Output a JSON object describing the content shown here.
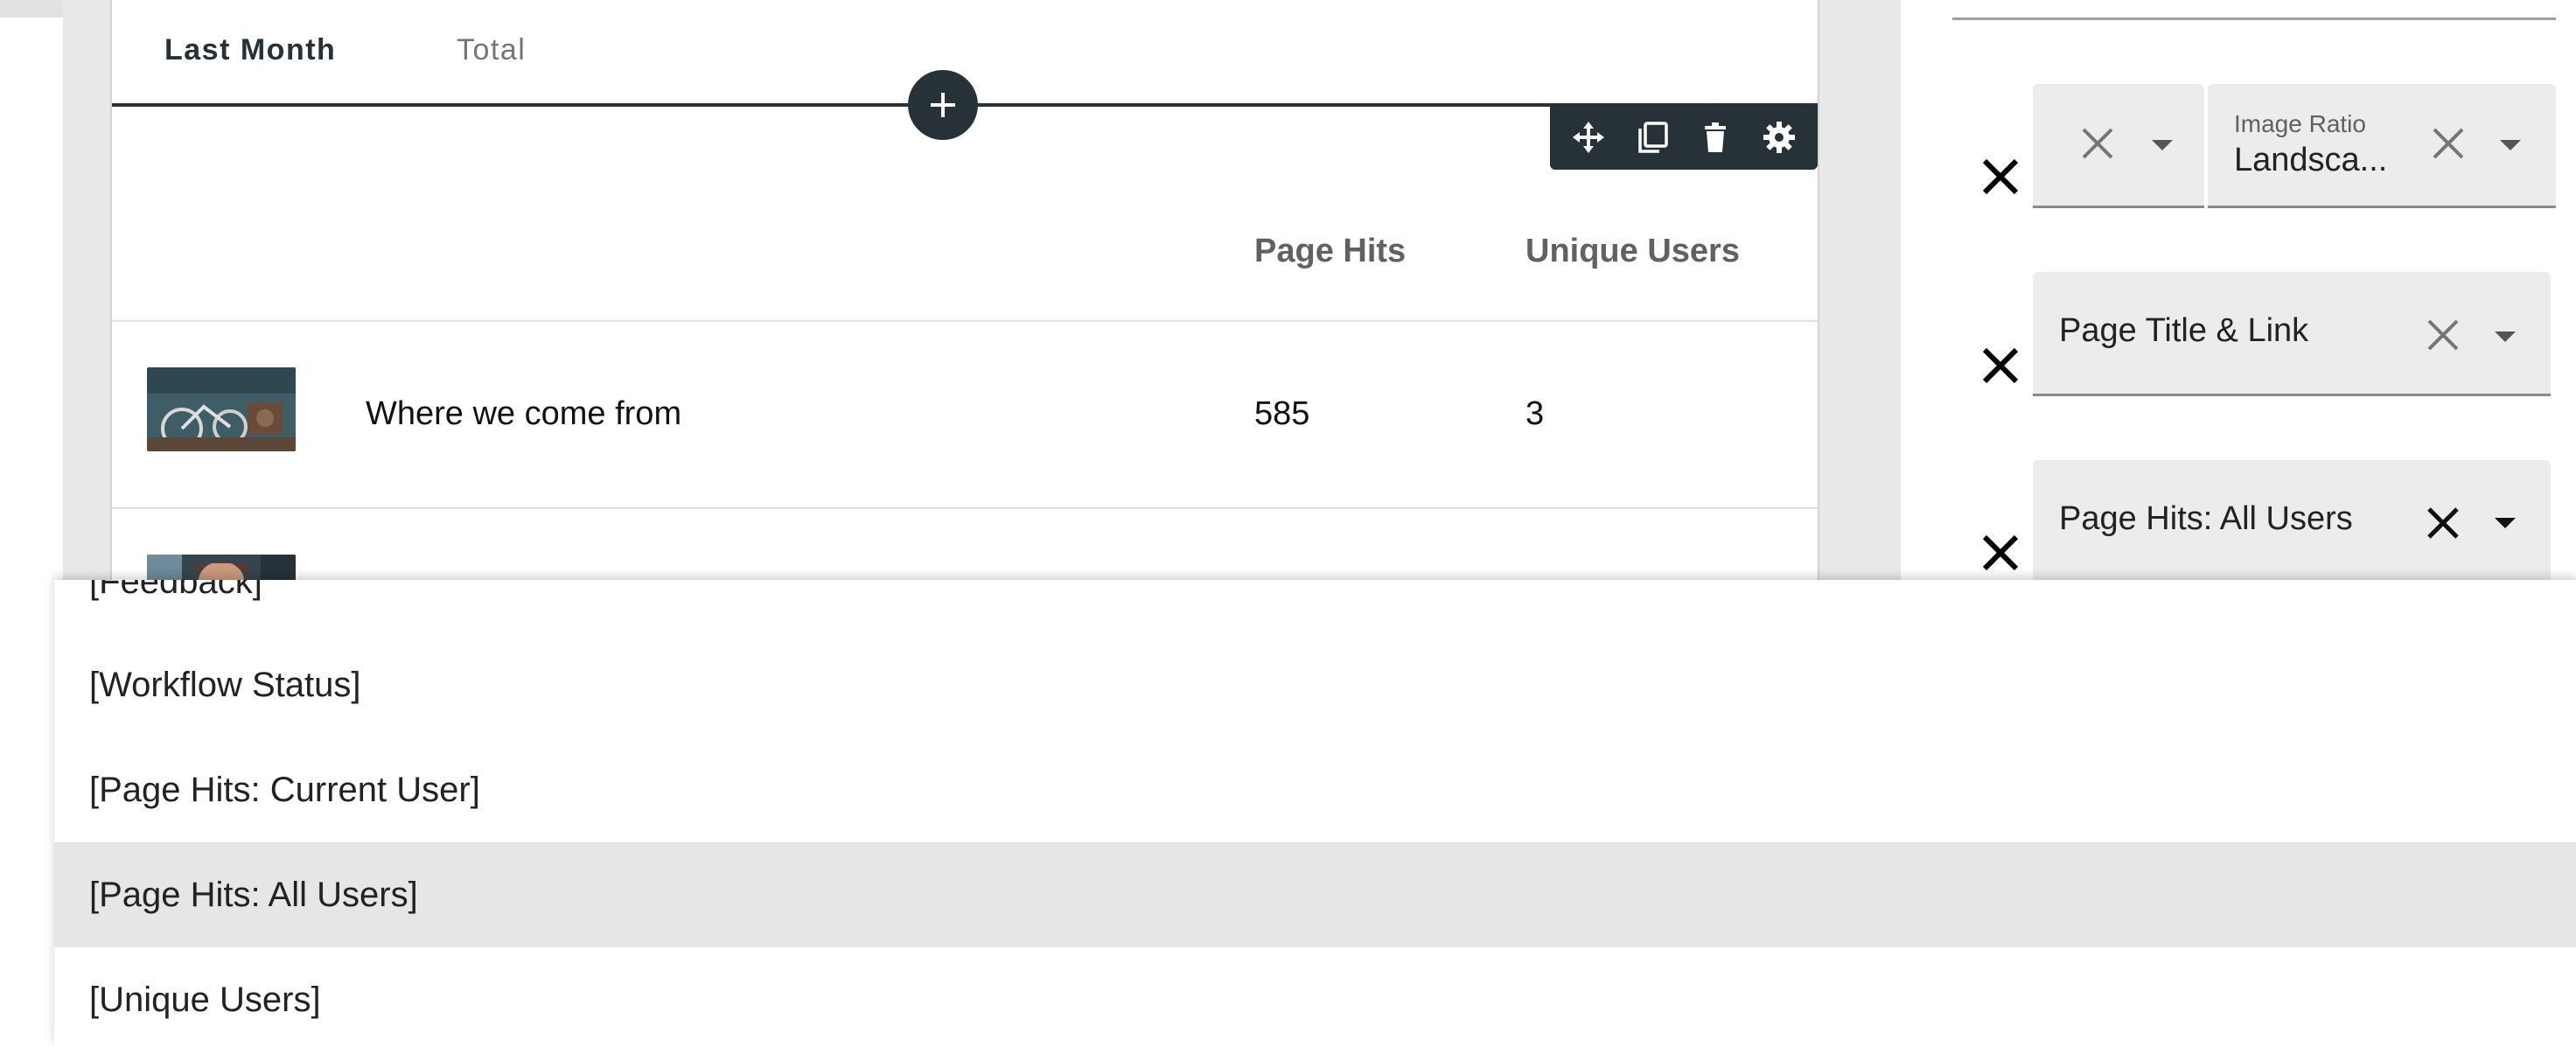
{
  "tabs": [
    {
      "label": "Last Month",
      "active": true
    },
    {
      "label": "Total",
      "active": false
    }
  ],
  "toolbar": {
    "icons": [
      "move-icon",
      "duplicate-icon",
      "delete-icon",
      "settings-icon"
    ]
  },
  "table": {
    "columns": [
      "",
      "",
      "Page Hits",
      "Unique Users"
    ],
    "rows": [
      {
        "title": "Where we come from",
        "page_hits": "585",
        "unique_users": "3"
      },
      {
        "title": "",
        "page_hits": "",
        "unique_users": ""
      }
    ]
  },
  "fields": [
    {
      "label": "",
      "value": ""
    },
    {
      "label": "Image Ratio",
      "value": "Landsca..."
    },
    {
      "label": "",
      "value": "Page Title & Link"
    },
    {
      "label": "",
      "value": "Page Hits: All Users"
    }
  ],
  "dropdown": {
    "options": [
      {
        "label": "[Feedback]",
        "selected": false
      },
      {
        "label": "[Workflow Status]",
        "selected": false
      },
      {
        "label": "[Page Hits: Current User]",
        "selected": false
      },
      {
        "label": "[Page Hits: All Users]",
        "selected": true
      },
      {
        "label": "[Unique Users]",
        "selected": false
      }
    ]
  },
  "colors": {
    "dark": "#263238",
    "selected_option": "#e6e6e6",
    "field_bg": "#ececec"
  }
}
